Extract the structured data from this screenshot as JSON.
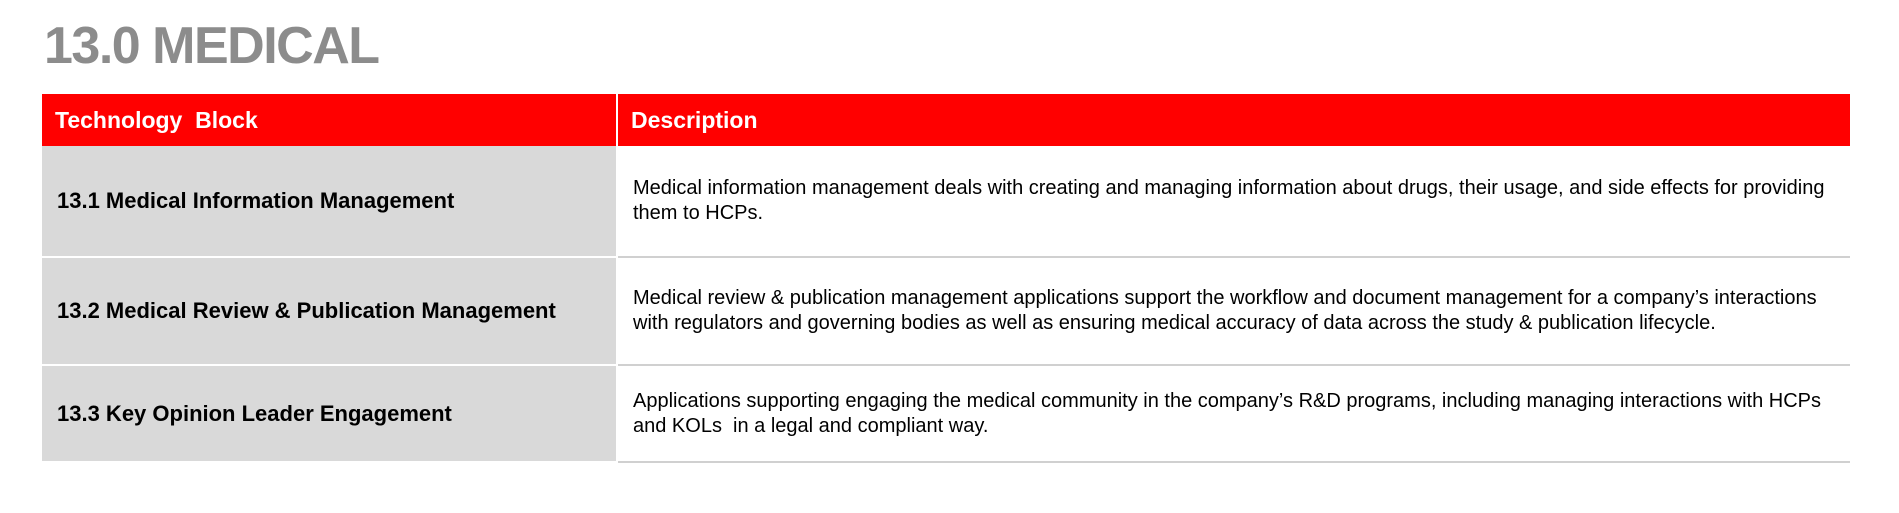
{
  "page": {
    "title": "13.0 MEDICAL"
  },
  "table": {
    "headers": {
      "block": "Technology  Block",
      "description": "Description"
    },
    "rows": [
      {
        "block": "13.1 Medical Information Management",
        "description": "Medical information management deals with creating and managing information about drugs, their usage, and side effects for providing them to HCPs."
      },
      {
        "block": "13.2 Medical Review & Publication Management",
        "description": "Medical review & publication management applications support the workflow and document management for a company’s interactions with regulators and governing bodies as well as ensuring medical accuracy of data across the study & publication lifecycle."
      },
      {
        "block": "13.3 Key Opinion Leader Engagement",
        "description": "Applications supporting engaging the medical community in the company’s R&D programs, including managing interactions with HCPs and KOLs  in a legal and compliant way."
      }
    ]
  },
  "colors": {
    "header_bg": "#ff0000",
    "block_bg": "#d9d9d9",
    "title": "#8c8c8c"
  }
}
